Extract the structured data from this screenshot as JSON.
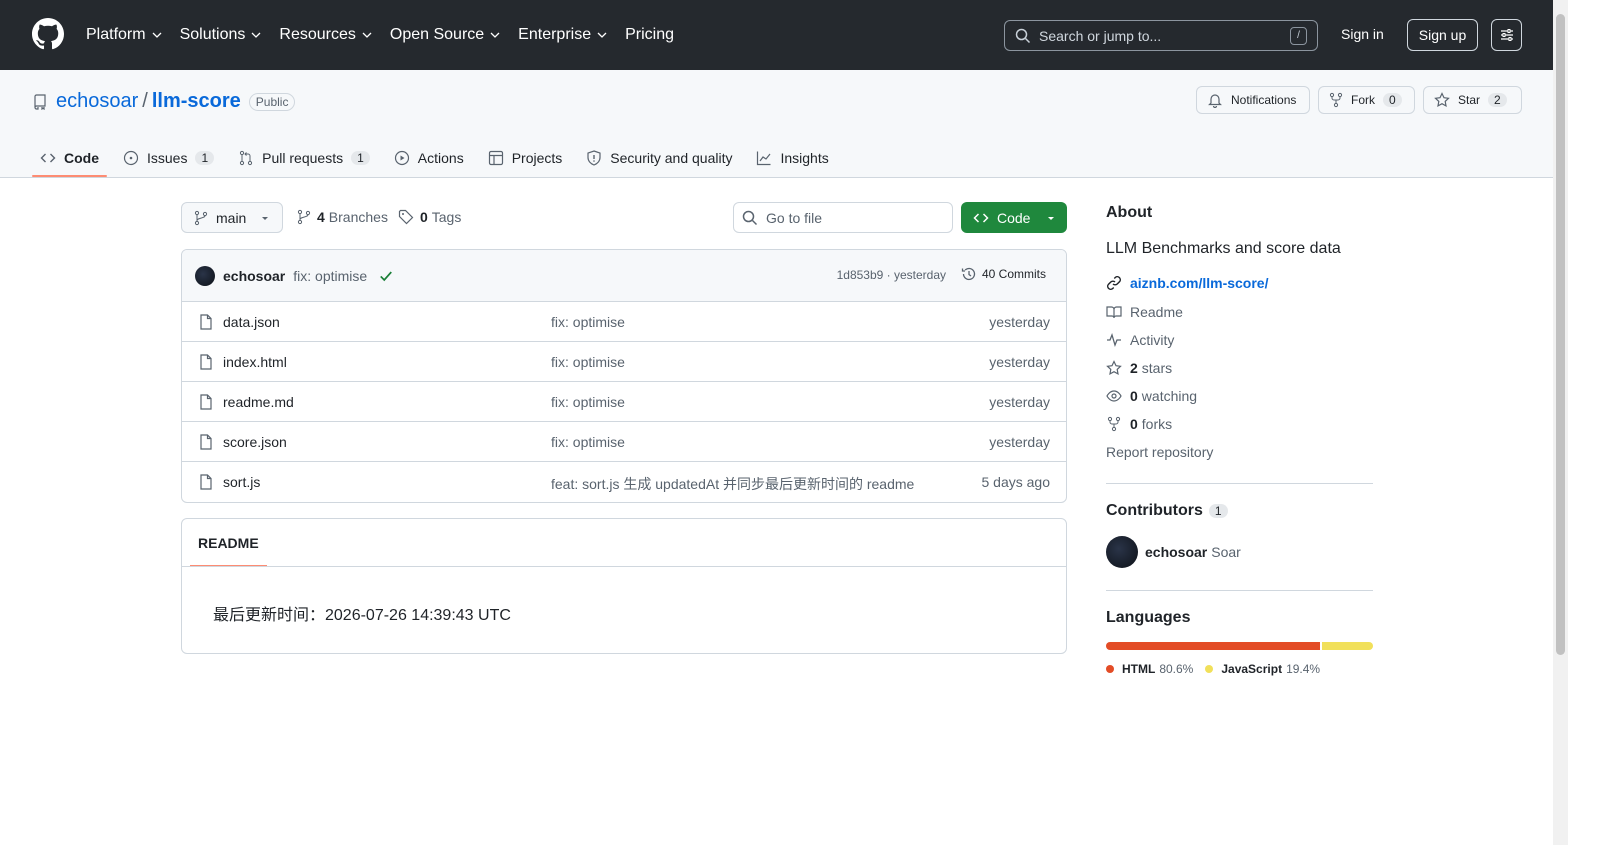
{
  "topnav": {
    "items": [
      "Platform",
      "Solutions",
      "Resources",
      "Open Source",
      "Enterprise",
      "Pricing"
    ],
    "search_placeholder": "Search or jump to...",
    "search_shortcut": "/",
    "sign_in": "Sign in",
    "sign_up": "Sign up"
  },
  "repo": {
    "owner": "echosoar",
    "separator": "/",
    "name": "llm-score",
    "visibility": "Public",
    "notifications_label": "Notifications",
    "fork_label": "Fork",
    "fork_count": "0",
    "star_label": "Star",
    "star_count": "2"
  },
  "tabs": [
    {
      "label": "Code",
      "count": null
    },
    {
      "label": "Issues",
      "count": "1"
    },
    {
      "label": "Pull requests",
      "count": "1"
    },
    {
      "label": "Actions",
      "count": null
    },
    {
      "label": "Projects",
      "count": null
    },
    {
      "label": "Security and quality",
      "count": null
    },
    {
      "label": "Insights",
      "count": null
    }
  ],
  "toolbar": {
    "branch": "main",
    "branches_count": "4",
    "branches_label": "Branches",
    "tags_count": "0",
    "tags_label": "Tags",
    "goto_placeholder": "Go to file",
    "code_label": "Code"
  },
  "latest_commit": {
    "author": "echosoar",
    "message": "fix: optimise",
    "hash_time": "1d853b9 · yesterday",
    "commits": "40 Commits"
  },
  "files": [
    {
      "name": "data.json",
      "message": "fix: optimise",
      "date": "yesterday"
    },
    {
      "name": "index.html",
      "message": "fix: optimise",
      "date": "yesterday"
    },
    {
      "name": "readme.md",
      "message": "fix: optimise",
      "date": "yesterday"
    },
    {
      "name": "score.json",
      "message": "fix: optimise",
      "date": "yesterday"
    },
    {
      "name": "sort.js",
      "message": "feat: sort.js 生成 updatedAt 并同步最后更新时间的 readme",
      "date": "5 days ago"
    }
  ],
  "readme": {
    "tab_label": "README",
    "body": "最后更新时间：2026-07-26 14:39:43 UTC"
  },
  "about": {
    "heading": "About",
    "description": "LLM Benchmarks and score data",
    "website": "aiznb.com/llm-score/",
    "readme": "Readme",
    "activity": "Activity",
    "stars_count": "2",
    "stars_label": "stars",
    "watching_count": "0",
    "watching_label": "watching",
    "forks_count": "0",
    "forks_label": "forks",
    "report": "Report repository"
  },
  "contributors": {
    "heading": "Contributors",
    "count": "1",
    "people": [
      {
        "login": "echosoar",
        "name": "Soar"
      }
    ]
  },
  "languages": {
    "heading": "Languages",
    "items": [
      {
        "name": "HTML",
        "percent": "80.6%",
        "value": 80.6,
        "color": "#e34c26"
      },
      {
        "name": "JavaScript",
        "percent": "19.4%",
        "value": 19.4,
        "color": "#f1e05a"
      }
    ]
  }
}
